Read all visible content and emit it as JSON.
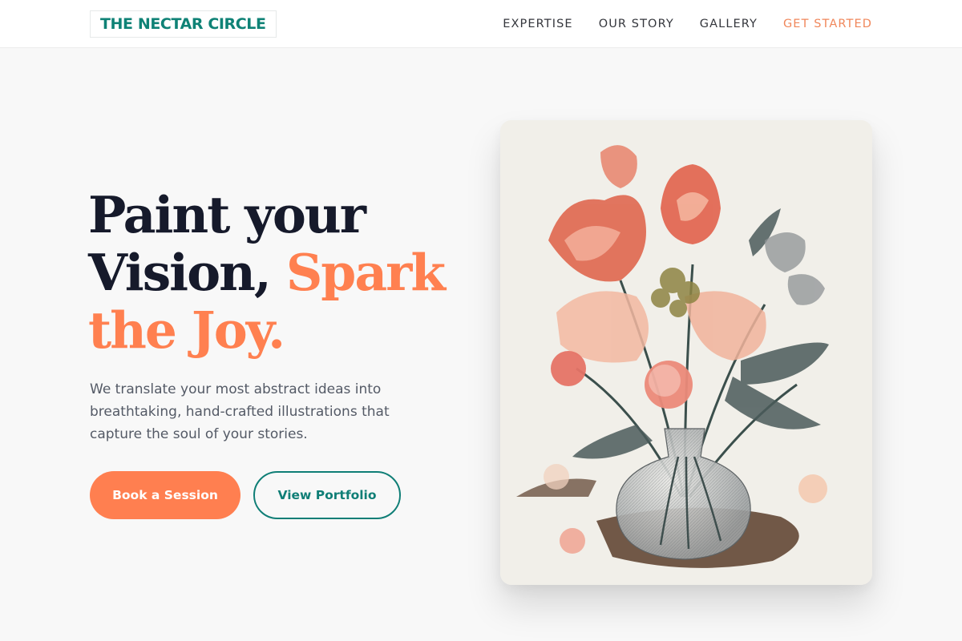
{
  "header": {
    "brand": "THE NECTAR CIRCLE",
    "nav": [
      {
        "label": "EXPERTISE"
      },
      {
        "label": "OUR STORY"
      },
      {
        "label": "GALLERY"
      },
      {
        "label": "GET STARTED"
      }
    ]
  },
  "hero": {
    "headline_line1": "Paint your",
    "headline_line2_plain": "Vision, ",
    "headline_line2_accent": "Spark",
    "headline_line3_accent": "the Joy.",
    "subtext": "We translate your most abstract ideas into breathtaking, hand-crafted illustrations that capture the soul of your stories.",
    "primary_button": "Book a Session",
    "secondary_button": "View Portfolio"
  },
  "artwork": {
    "description": "vintage-botanical-flower-vase-illustration"
  },
  "colors": {
    "teal": "#0f8276",
    "coral": "#ff7f50",
    "navy": "#161a2b",
    "text_muted": "#545a66",
    "page_bg": "#f8f8f8"
  }
}
